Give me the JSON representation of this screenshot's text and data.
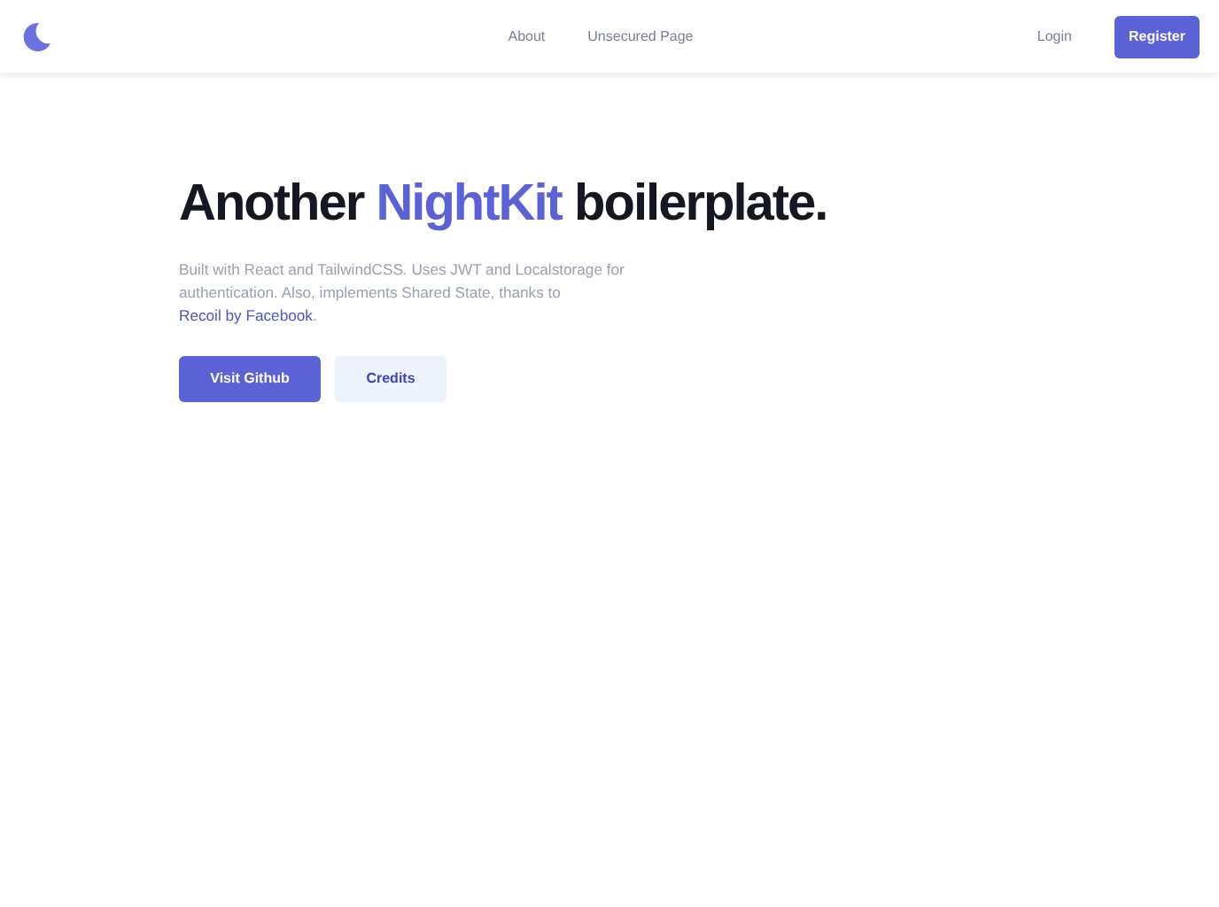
{
  "navbar": {
    "links": [
      "About",
      "Unsecured Page"
    ],
    "login": "Login",
    "register": "Register"
  },
  "hero": {
    "title_before": "Another ",
    "title_highlight": "NightKit",
    "title_after": " boilerplate.",
    "description_before": "Built with React and TailwindCSS. Uses JWT and Localstorage for authentication. Also, implements Shared State, thanks to ",
    "description_link": "Recoil by Facebook",
    "description_after": ".",
    "buttons": [
      {
        "label": "Visit Github",
        "kind": "primary"
      },
      {
        "label": "Credits",
        "kind": "secondary"
      }
    ]
  }
}
